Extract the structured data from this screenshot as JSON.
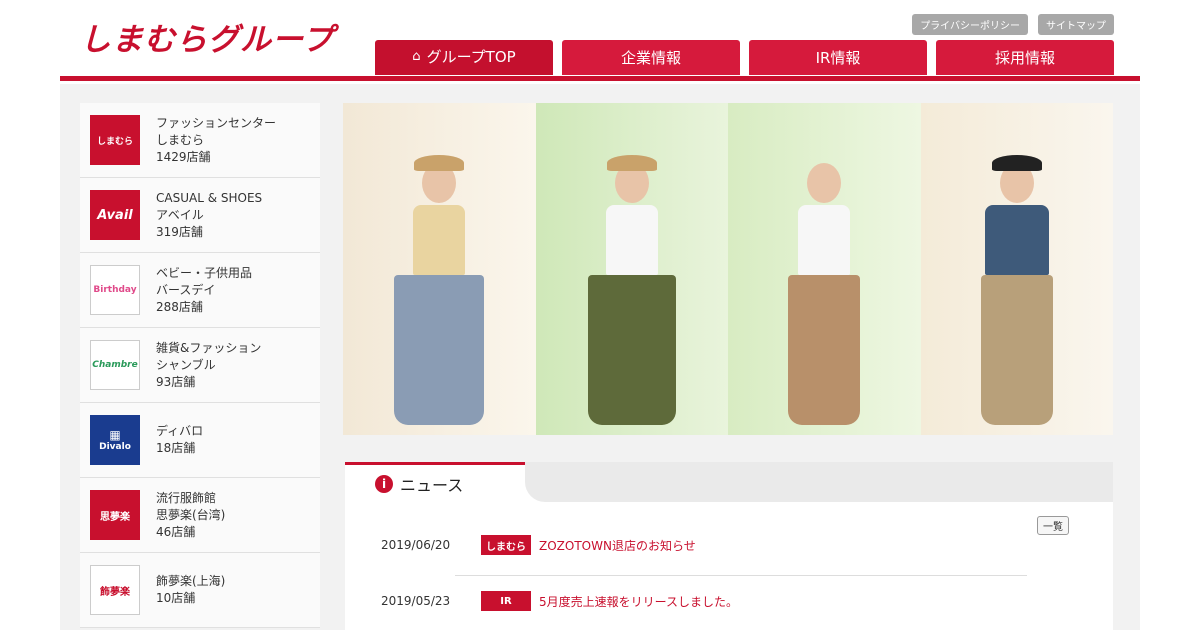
{
  "header": {
    "logo_text": "しまむらグループ",
    "util_links": [
      "プライバシーポリシー",
      "サイトマップ"
    ],
    "nav": [
      {
        "label": "グループTOP",
        "active": true
      },
      {
        "label": "企業情報",
        "active": false
      },
      {
        "label": "IR情報",
        "active": false
      },
      {
        "label": "採用情報",
        "active": false
      }
    ]
  },
  "sidebar": {
    "brands": [
      {
        "logo": "しまむら",
        "lines": [
          "ファッションセンター",
          "しまむら",
          "1429店舗"
        ]
      },
      {
        "logo": "Avail",
        "lines": [
          "CASUAL & SHOES",
          "アベイル",
          "319店舗"
        ]
      },
      {
        "logo": "Birthday",
        "lines": [
          "ベビー・子供用品",
          "バースデイ",
          "288店舗"
        ]
      },
      {
        "logo": "Chambre",
        "lines": [
          "雑貨&ファッション",
          "シャンブル",
          "93店舗"
        ]
      },
      {
        "logo": "Divalo",
        "lines": [
          "ディバロ",
          "18店舗"
        ]
      },
      {
        "logo": "思夢楽",
        "lines": [
          "流行服飾館",
          "思夢楽(台湾)",
          "46店舗"
        ]
      },
      {
        "logo": "飾夢楽",
        "lines": [
          "飾夢楽(上海)",
          "10店舗"
        ]
      }
    ]
  },
  "news": {
    "title": "ニュース",
    "list_all": "一覧",
    "items": [
      {
        "date": "2019/06/20",
        "tag": "しまむら",
        "title": "ZOZOTOWN退店のお知らせ"
      },
      {
        "date": "2019/05/23",
        "tag": "IR",
        "title": "5月度売上速報をリリースしました。"
      }
    ]
  },
  "colors": {
    "brand_red": "#c8102e"
  }
}
